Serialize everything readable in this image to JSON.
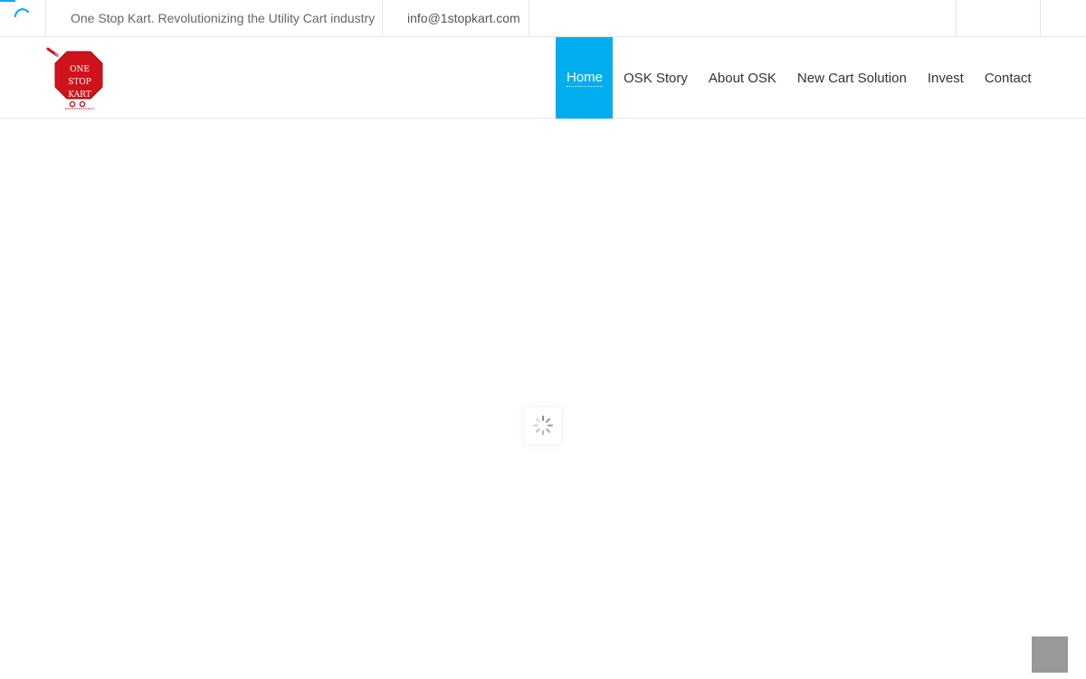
{
  "topbar": {
    "tagline": "One Stop Kart. Revolutionizing the Utility Cart industry",
    "email": "info@1stopkart.com",
    "accent_color": "#00aeef",
    "spinner_icon": "loading-spinner-icon"
  },
  "logo": {
    "line1": "ONE",
    "line2": "STOP",
    "line3": "KART",
    "color": "#d0121b"
  },
  "nav": {
    "items": [
      {
        "label": "Home",
        "active": true
      },
      {
        "label": "OSK Story"
      },
      {
        "label": "About OSK"
      },
      {
        "label": "New Cart Solution"
      },
      {
        "label": "Invest"
      },
      {
        "label": "Contact"
      }
    ],
    "active_color": "#00aeef"
  },
  "loader": {
    "icon": "spinner-icon"
  },
  "back_to_top": {
    "icon": "back-to-top-icon",
    "color": "#999999"
  }
}
